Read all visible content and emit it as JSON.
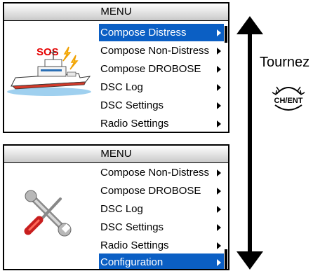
{
  "screen_top": {
    "title": "MENU",
    "items": [
      {
        "label": "Compose Distress",
        "selected": true
      },
      {
        "label": "Compose Non-Distress",
        "selected": false
      },
      {
        "label": "Compose DROBOSE",
        "selected": false
      },
      {
        "label": "DSC Log",
        "selected": false
      },
      {
        "label": "DSC Settings",
        "selected": false
      },
      {
        "label": "Radio Settings",
        "selected": false
      }
    ],
    "illustration_text": "SOS"
  },
  "screen_bottom": {
    "title": "MENU",
    "items": [
      {
        "label": "Compose Non-Distress",
        "selected": false
      },
      {
        "label": "Compose DROBOSE",
        "selected": false
      },
      {
        "label": "DSC Log",
        "selected": false
      },
      {
        "label": "DSC Settings",
        "selected": false
      },
      {
        "label": "Radio Settings",
        "selected": false
      },
      {
        "label": "Configuration",
        "selected": true
      }
    ]
  },
  "instruction": "Tournez",
  "dial_label": "CH/ENT",
  "colors": {
    "selection": "#0b5fc4",
    "sos": "#e60000"
  }
}
